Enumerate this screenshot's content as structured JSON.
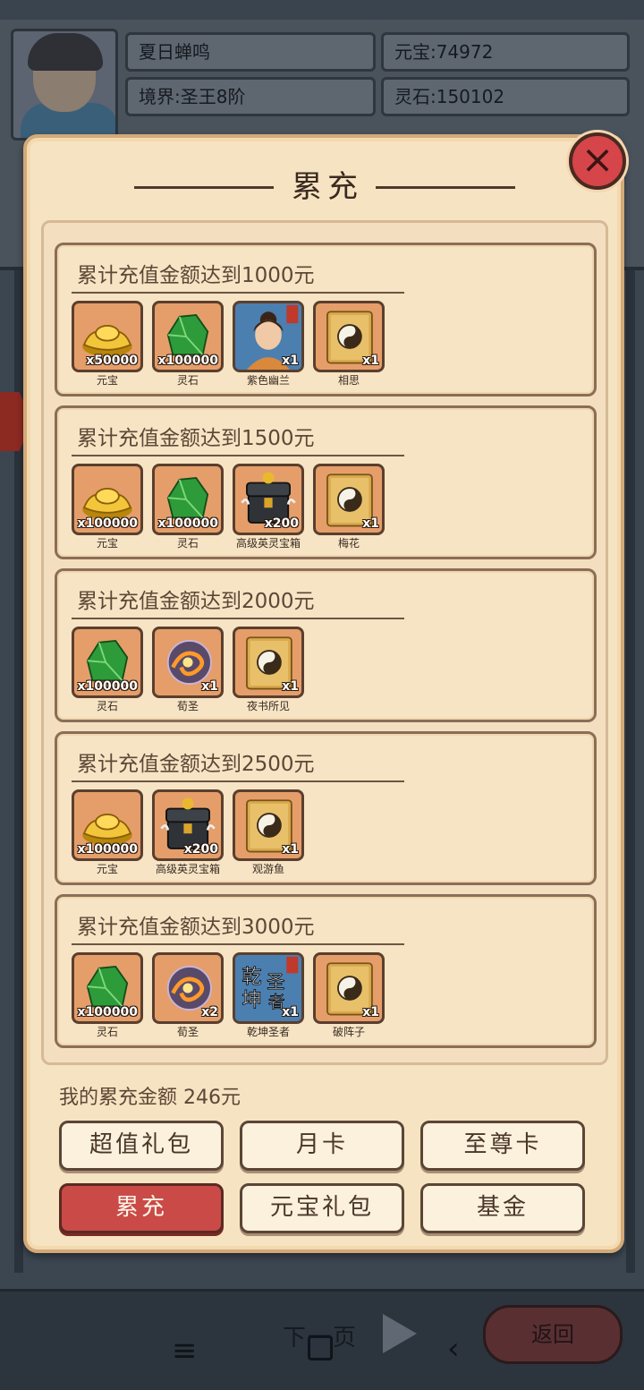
{
  "profile": {
    "name": "夏日蝉鸣",
    "realm": "境界:圣王8阶",
    "yuanbao": "元宝:74972",
    "lingshi": "灵石:150102"
  },
  "modal": {
    "title": "累充",
    "close_icon": "close-icon",
    "tiers": [
      {
        "title": "累计充值金额达到1000元",
        "items": [
          {
            "name": "元宝",
            "qty": "x50000",
            "icon": "gold-ingot-icon"
          },
          {
            "name": "灵石",
            "qty": "x100000",
            "icon": "green-stone-icon"
          },
          {
            "name": "紫色幽兰",
            "qty": "x1",
            "icon": "portrait-icon"
          },
          {
            "name": "相思",
            "qty": "x1",
            "icon": "taiji-book-icon"
          }
        ]
      },
      {
        "title": "累计充值金额达到1500元",
        "items": [
          {
            "name": "元宝",
            "qty": "x100000",
            "icon": "gold-ingot-icon"
          },
          {
            "name": "灵石",
            "qty": "x100000",
            "icon": "green-stone-icon"
          },
          {
            "name": "高级英灵宝箱",
            "qty": "x200",
            "icon": "treasure-chest-icon"
          },
          {
            "name": "梅花",
            "qty": "x1",
            "icon": "taiji-book-icon"
          }
        ]
      },
      {
        "title": "累计充值金额达到2000元",
        "items": [
          {
            "name": "灵石",
            "qty": "x100000",
            "icon": "green-stone-icon"
          },
          {
            "name": "荀圣",
            "qty": "x1",
            "icon": "orb-icon"
          },
          {
            "name": "夜书所见",
            "qty": "x1",
            "icon": "taiji-book-icon"
          }
        ]
      },
      {
        "title": "累计充值金额达到2500元",
        "items": [
          {
            "name": "元宝",
            "qty": "x100000",
            "icon": "gold-ingot-icon"
          },
          {
            "name": "高级英灵宝箱",
            "qty": "x200",
            "icon": "treasure-chest-icon"
          },
          {
            "name": "观游鱼",
            "qty": "x1",
            "icon": "taiji-book-icon"
          }
        ]
      },
      {
        "title": "累计充值金额达到3000元",
        "items": [
          {
            "name": "灵石",
            "qty": "x100000",
            "icon": "green-stone-icon"
          },
          {
            "name": "荀圣",
            "qty": "x2",
            "icon": "orb-icon"
          },
          {
            "name": "乾坤圣者",
            "qty": "x1",
            "icon": "calligraphy-icon"
          },
          {
            "name": "破阵子",
            "qty": "x1",
            "icon": "taiji-book-icon"
          }
        ]
      }
    ],
    "my_total": "我的累充金额 246元",
    "buttons": [
      {
        "label": "超值礼包",
        "active": false
      },
      {
        "label": "月卡",
        "active": false
      },
      {
        "label": "至尊卡",
        "active": false
      },
      {
        "label": "累充",
        "active": true
      },
      {
        "label": "元宝礼包",
        "active": false
      },
      {
        "label": "基金",
        "active": false
      }
    ]
  },
  "footer": {
    "next_page": "下一页",
    "back": "返回"
  },
  "colors": {
    "panel": "#f6e3c2",
    "active_button": "#c94a47",
    "item_bg": "#e59e6a"
  }
}
